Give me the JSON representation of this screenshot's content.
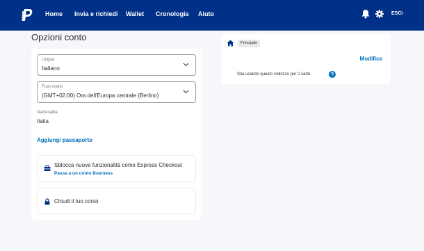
{
  "nav": {
    "items": [
      {
        "label": "Home"
      },
      {
        "label": "Invia e richiedi"
      },
      {
        "label": "Wallet"
      },
      {
        "label": "Cronologia"
      },
      {
        "label": "Aiuto"
      }
    ],
    "logout_label": "ESCI"
  },
  "page_title": "Opzioni conto",
  "account_options": {
    "language": {
      "label": "Lingua",
      "value": "Italiano"
    },
    "timezone": {
      "label": "Fuso orario",
      "value": "(GMT+02:00) Ora dell'Europa centrale (Berlino)"
    },
    "nationality": {
      "label": "Nazionalità",
      "value": "Italia"
    },
    "add_passport_link": "Aggiungi passaporto",
    "business_tile": {
      "title": "Sblocca nuove funzionalità come Express Checkout",
      "link": "Passa a un conto Business"
    },
    "close_tile": {
      "title": "Chiudi il tuo conto"
    }
  },
  "address_card": {
    "badge": "Principale",
    "edit_link": "Modifica",
    "note": "Stai usando questo indirizzo per 2 carte"
  },
  "colors": {
    "nav_background": "#003087",
    "link_blue": "#0070ba",
    "page_background": "#f5f7fa"
  },
  "icons": [
    "paypal-logo",
    "bell-icon",
    "gear-icon",
    "chevron-down-icon",
    "briefcase-icon",
    "lock-icon",
    "home-icon",
    "help-icon"
  ]
}
